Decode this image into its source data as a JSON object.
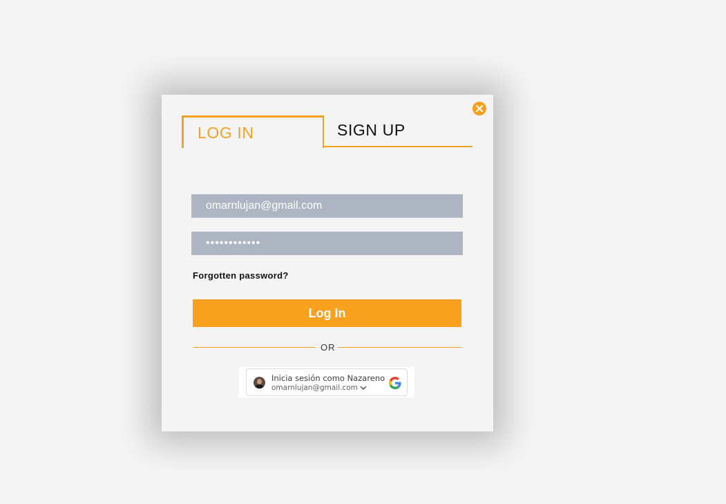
{
  "modal": {
    "tabs": {
      "login_label": "LOG IN",
      "signup_label": "SIGN UP"
    },
    "form": {
      "email_value": "omarnlujan@gmail.com",
      "password_value": "••••••••••••",
      "forgot_label": "Forgotten password?",
      "login_button_label": "Log In",
      "or_label": "OR"
    },
    "google": {
      "name_label": "Inicia sesión como Nazareno",
      "email_label": "omarnlujan@gmail.com",
      "logo_icon": "google-g-icon",
      "avatar_icon": "avatar"
    }
  },
  "colors": {
    "accent": "#f7a01e",
    "input_bg": "#aeb5c2",
    "background": "#f4f4f4"
  }
}
